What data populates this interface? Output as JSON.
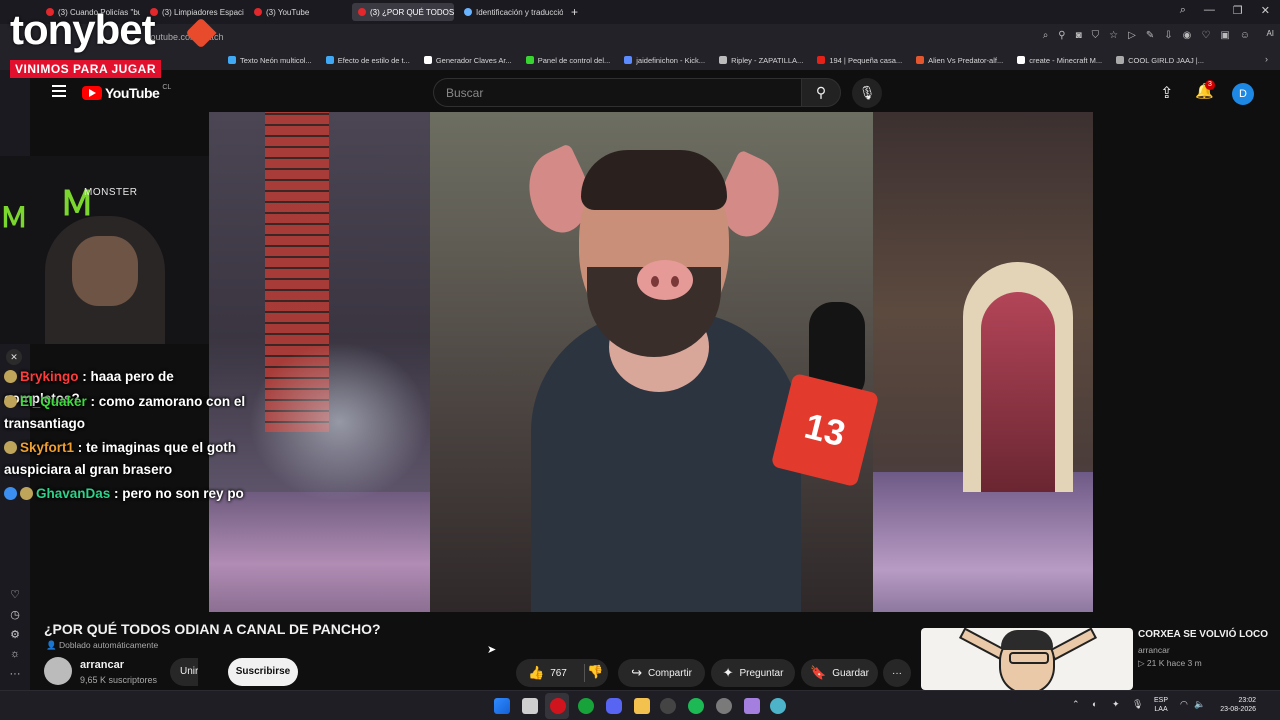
{
  "browser": {
    "tabs": [
      {
        "label": "(3) Cuando Policías \"buen",
        "active": false
      },
      {
        "label": "(3) Limpiadores Espaciale",
        "active": false
      },
      {
        "label": "(3) YouTube",
        "active": false
      },
      {
        "label": "(3) ¿POR QUÉ TODOS OD",
        "active": true
      },
      {
        "label": "Identificación y traducció",
        "active": false
      }
    ],
    "new_tab": "+",
    "url": "youtube.com/watch",
    "ai_label": "AI",
    "bookmarks": [
      "Texto Neón multicol...",
      "Efecto de estilo de t...",
      "Generador Claves Ar...",
      "Panel de control del...",
      "jaidefinichon - Kick...",
      "Ripley - ZAPATILLA...",
      "194 | Pequeña casa...",
      "Alien Vs Predator-alf...",
      "create - Minecraft M...",
      "COOL GIRLD JAAJ |..."
    ],
    "bookmark_colors": [
      "#3fa9f5",
      "#3fa9f5",
      "#ffffff",
      "#38d430",
      "#5b8bff",
      "#bbbbbb",
      "#e62117",
      "#e4572e",
      "#ffffff",
      "#aaaaaa"
    ]
  },
  "overlay": {
    "brand": "tonybet",
    "slogan": "VINIMOS PARA JUGAR",
    "sponsor": "MONSTER",
    "brand_color": "#e84a2c"
  },
  "youtube": {
    "logo": "YouTube",
    "country": "CL",
    "search_placeholder": "Buscar",
    "notifications": "3",
    "avatar_letter": "D"
  },
  "chat": {
    "messages": [
      {
        "user": "Brykingo",
        "text": " : haaa pero de completos?",
        "color": "#ff3b3b"
      },
      {
        "user": "El_Quaker",
        "text": " : como zamorano con el transantiago",
        "color": "#3edb3e"
      },
      {
        "user": "Skyfort1",
        "text": " : te imaginas que el goth auspiciara al gran brasero",
        "color": "#f0a030"
      },
      {
        "user": "GhavanDas",
        "text": " : pero no son rey po",
        "color": "#2fd08a"
      }
    ]
  },
  "video": {
    "title": "¿POR QUÉ TODOS ODIAN A CANAL DE PANCHO?",
    "dubbing": "Doblado automáticamente",
    "mic_number": "13",
    "channel": {
      "name": "arrancar",
      "subscribers": "9,65 K suscriptores"
    },
    "join_label": "Unirme",
    "subscribe_label": "Suscribirse",
    "likes": "767",
    "share_label": "Compartir",
    "ask_label": "Preguntar",
    "save_label": "Guardar",
    "more_label": "···"
  },
  "recommended": {
    "title": "CORXEA SE VOLVIÓ LOCO",
    "channel": "arrancar",
    "views": "▷ 21 K",
    "age": "hace 3 m"
  },
  "taskbar": {
    "lang_line1": "ESP",
    "lang_line2": "LAA",
    "time": "23:02",
    "date": "23-08-2026"
  }
}
